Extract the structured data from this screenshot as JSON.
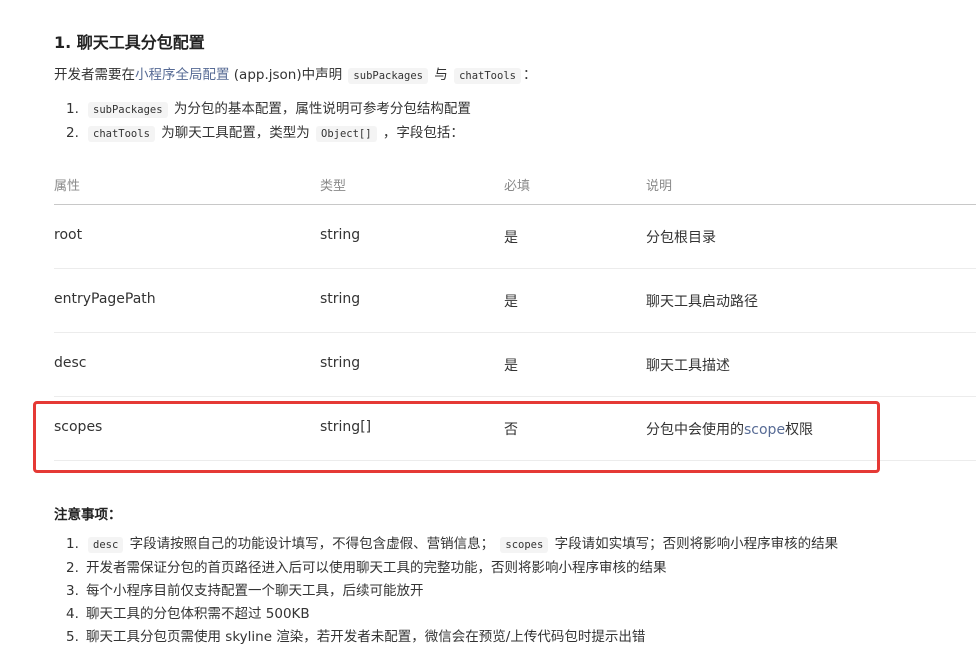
{
  "section": {
    "title": "1. 聊天工具分包配置"
  },
  "intro": {
    "prefix": "开发者需要在",
    "link": "小程序全局配置",
    "suffix1": " (app.json)中声明 ",
    "code1": "subPackages",
    "mid": " 与 ",
    "code2": "chatTools",
    "suffix2": "："
  },
  "config_list": [
    {
      "num": "1.",
      "code": "subPackages",
      "text": "为分包的基本配置，属性说明可参考分包结构配置"
    },
    {
      "num": "2.",
      "code": "chatTools",
      "text_before": "为聊天工具配置，类型为",
      "type_code": "Object[]",
      "text_after": "，字段包括："
    }
  ],
  "table": {
    "headers": [
      "属性",
      "类型",
      "必填",
      "说明"
    ],
    "rows": [
      {
        "prop": "root",
        "type": "string",
        "required": "是",
        "desc": "分包根目录"
      },
      {
        "prop": "entryPagePath",
        "type": "string",
        "required": "是",
        "desc": "聊天工具启动路径"
      },
      {
        "prop": "desc",
        "type": "string",
        "required": "是",
        "desc": "聊天工具描述"
      },
      {
        "prop": "scopes",
        "type": "string[]",
        "required": "否",
        "desc_before": "分包中会使用的",
        "desc_link": "scope",
        "desc_after": "权限"
      }
    ]
  },
  "notice": {
    "title": "注意事项：",
    "items": [
      {
        "num": "1.",
        "code1": "desc",
        "text1": "字段请按照自己的功能设计填写，不得包含虚假、营销信息；",
        "code2": "scopes",
        "text2": "字段请如实填写；否则将影响小程序审核的结果"
      },
      {
        "num": "2.",
        "text": "开发者需保证分包的首页路径进入后可以使用聊天工具的完整功能，否则将影响小程序审核的结果"
      },
      {
        "num": "3.",
        "text": "每个小程序目前仅支持配置一个聊天工具，后续可能放开"
      },
      {
        "num": "4.",
        "text": "聊天工具的分包体积需不超过 500KB"
      },
      {
        "num": "5.",
        "text": "聊天工具分包页需使用 skyline 渲染，若开发者未配置，微信会在预览/上传代码包时提示出错"
      }
    ]
  },
  "colors": {
    "link": "#576b95",
    "highlight_border": "#e53935"
  }
}
